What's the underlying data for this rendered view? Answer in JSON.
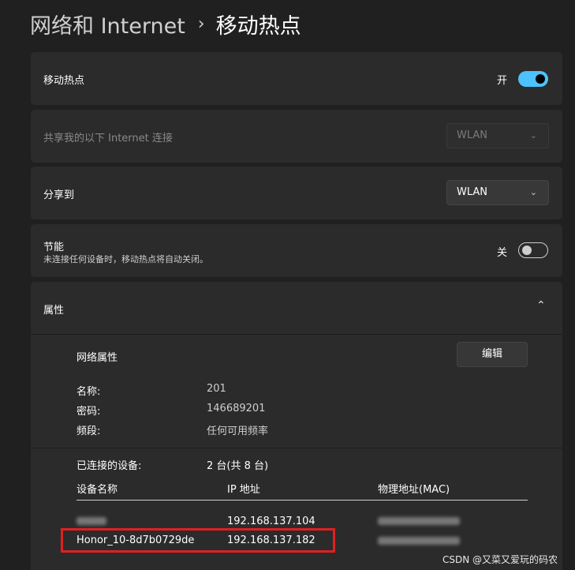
{
  "breadcrumb": {
    "parent": "网络和 Internet",
    "separator": "›",
    "current": "移动热点"
  },
  "hotspot": {
    "label": "移动热点",
    "state": "开",
    "enabled": true
  },
  "share_from": {
    "label": "共享我的以下 Internet 连接",
    "value": "WLAN"
  },
  "share_to": {
    "label": "分享到",
    "value": "WLAN"
  },
  "power_saving": {
    "title": "节能",
    "description": "未连接任何设备时，移动热点将自动关闭。",
    "state": "关",
    "enabled": false
  },
  "properties": {
    "label": "属性",
    "network_properties_label": "网络属性",
    "edit_button": "编辑",
    "name_label": "名称:",
    "name_value": "201",
    "password_label": "密码:",
    "password_value": "146689201",
    "band_label": "频段:",
    "band_value": "任何可用频率"
  },
  "devices": {
    "connected_label": "已连接的设备:",
    "connected_count": "2 台(共 8 台)",
    "columns": [
      "设备名称",
      "IP 地址",
      "物理地址(MAC)"
    ],
    "rows": [
      {
        "name": "",
        "ip": "192.168.137.104",
        "mac": ""
      },
      {
        "name": "Honor_10-8d7b0729de",
        "ip": "192.168.137.182",
        "mac": ""
      }
    ]
  },
  "watermark": "CSDN @又菜又爱玩的码农",
  "colors": {
    "accent": "#4cc2ff",
    "highlight": "#e02020",
    "background": "#202020",
    "card": "#2b2b2b"
  },
  "icons": {
    "chevron_right": "chevron-right-icon",
    "chevron_down": "chevron-down-icon",
    "chevron_up": "chevron-up-icon"
  }
}
